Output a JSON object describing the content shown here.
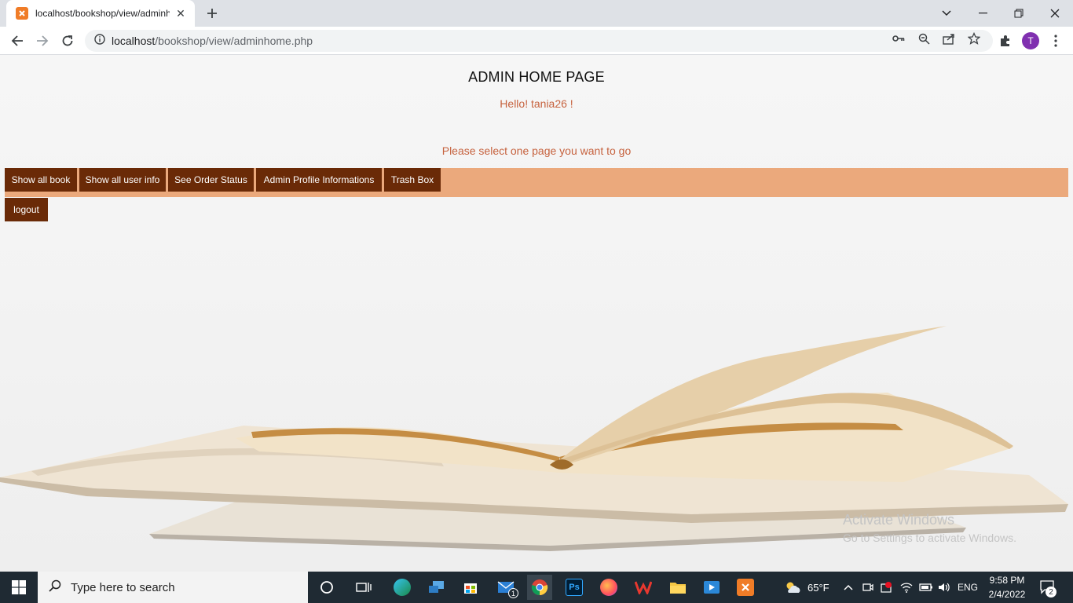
{
  "browser": {
    "tab_title": "localhost/bookshop/view/adminhome.php",
    "url_host": "localhost",
    "url_path": "/bookshop/view/adminhome.php",
    "avatar_letter": "T"
  },
  "page": {
    "heading": "ADMIN HOME PAGE",
    "greeting": "Hello! tania26 !",
    "instruction": "Please select one page you want to go",
    "nav": [
      {
        "label": "Show all book"
      },
      {
        "label": "Show all user info"
      },
      {
        "label": "See Order Status"
      },
      {
        "label": "Admin Profile Informations"
      },
      {
        "label": "Trash Box"
      },
      {
        "label": "logout"
      }
    ],
    "watermark": {
      "title": "Activate Windows",
      "subtitle": "Go to Settings to activate Windows."
    }
  },
  "taskbar": {
    "search_placeholder": "Type here to search",
    "weather": "65°F",
    "language": "ENG",
    "time": "9:58 PM",
    "date": "2/4/2022",
    "notification_count": "2",
    "mail_badge": "1"
  },
  "colors": {
    "nav_bar": "#eba97c",
    "nav_button": "#6a2a07",
    "accent_text": "#c6623e"
  }
}
